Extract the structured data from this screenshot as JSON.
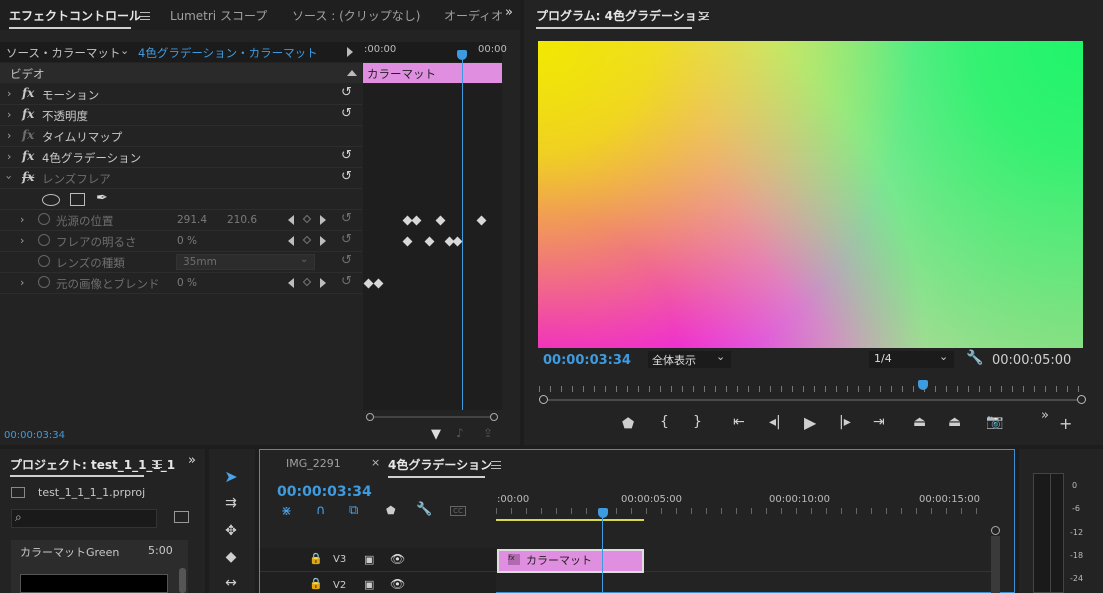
{
  "effect_controls": {
    "tabs": [
      "エフェクトコントロール",
      "Lumetri スコープ",
      "ソース : (クリップなし)",
      "オーディオ"
    ],
    "source_label": "ソース・カラーマット",
    "clip_label": "4色グラデーション・カラーマット",
    "ruler_start": ":00:00",
    "ruler_end": "00:00",
    "clip_bar_label": "カラーマット",
    "video_header": "ビデオ",
    "rows": [
      {
        "label": "モーション"
      },
      {
        "label": "不透明度"
      },
      {
        "label": "タイムリマップ"
      },
      {
        "label": "4色グラデーション"
      },
      {
        "label": "レンズフレア"
      }
    ],
    "params": [
      {
        "label": "光源の位置",
        "v1": "291.4",
        "v2": "210.6"
      },
      {
        "label": "フレアの明るさ",
        "v1": "0 %"
      },
      {
        "label": "レンズの種類",
        "v1": "35mm"
      },
      {
        "label": "元の画像とブレンド",
        "v1": "0 %"
      }
    ],
    "timecode": "00:00:03:34",
    "fx_symbol": "fx"
  },
  "program": {
    "title": "プログラム: 4色グラデーション",
    "timecode": "00:00:03:34",
    "zoom": "全体表示",
    "resolution": "1/4",
    "duration": "00:00:05:00",
    "playhead_fraction": 0.7,
    "colors": {
      "top_left": "#f2e800",
      "top_right": "#1ef56a",
      "bottom_left": "#f200f0",
      "bottom_right": "#a8d98a"
    }
  },
  "project": {
    "title": "プロジェクト: test_1_1_1_1",
    "file": "test_1_1_1_1.prproj",
    "item_name": "カラーマットGreen",
    "item_duration": "5:00"
  },
  "timeline": {
    "tabs": [
      "IMG_2291",
      "4色グラデーション"
    ],
    "timecode": "00:00:03:34",
    "ruler": [
      ":00:00",
      "00:00:05:00",
      "00:00:10:00",
      "00:00:15:00"
    ],
    "tracks": [
      "V3",
      "V2"
    ],
    "clip_label": "カラーマット"
  },
  "meter": {
    "scale": [
      "0",
      "-6",
      "-12",
      "-18",
      "-24"
    ]
  },
  "accent": "#3e9bdf",
  "clip_color": "#e08ee0"
}
